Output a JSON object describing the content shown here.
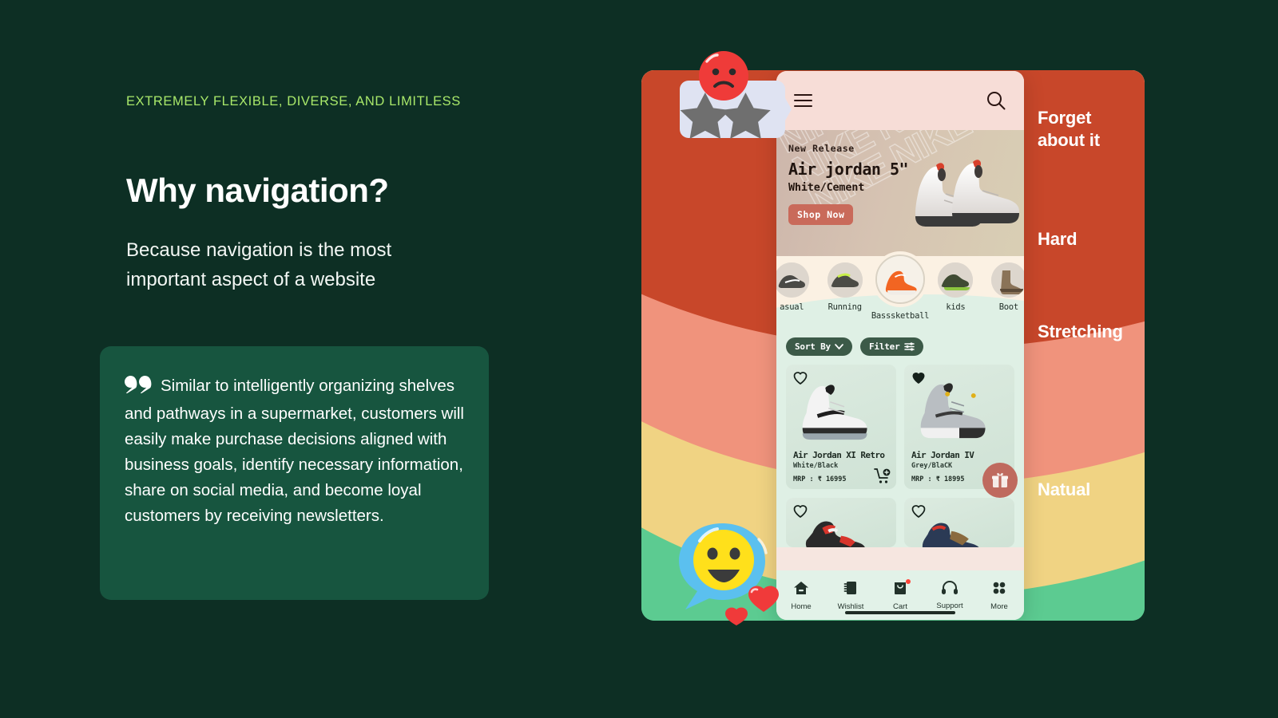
{
  "slide": {
    "eyebrow": "EXTREMELY FLEXIBLE, DIVERSE, AND LIMITLESS",
    "headline": "Why navigation?",
    "subhead": "Because navigation is the most important aspect of a website",
    "quote": "Similar to intelligently organizing shelves and pathways in a supermarket, customers will easily make purchase decisions aligned with business goals, identify necessary information, share on social media, and become loyal customers by receiving newsletters."
  },
  "colors": {
    "background": "#0d2f24",
    "eyebrow_green": "#a9e86a",
    "quote_card": "#17553f",
    "band_red": "#c8472a",
    "band_salmon": "#f0937c",
    "band_yellow": "#f0d383",
    "band_green": "#5ccb91",
    "accent_brick": "#c96a5a",
    "chip_dark": "#3c5a48",
    "badge_red": "#ff4438"
  },
  "bands": [
    {
      "label": "Forget about it",
      "color": "#c8472a"
    },
    {
      "label": "Hard",
      "color": "#f0937c"
    },
    {
      "label": "Stretching",
      "color": "#f0d383"
    },
    {
      "label": "Natual",
      "color": "#5ccb91"
    }
  ],
  "phone": {
    "topbar": {
      "menu_icon": "hamburger-icon",
      "search_icon": "search-icon"
    },
    "hero": {
      "watermark": "NIKE",
      "eyebrow": "New Release",
      "title": "Air jordan 5\"",
      "subtitle": "White/Cement",
      "cta": "Shop Now"
    },
    "categories": [
      {
        "label": "asual",
        "selected": false
      },
      {
        "label": "Running",
        "selected": false
      },
      {
        "label": "Basssketball",
        "selected": true
      },
      {
        "label": "kids",
        "selected": false
      },
      {
        "label": "Boot",
        "selected": false
      }
    ],
    "filters": {
      "sort_label": "Sort By",
      "filter_label": "Filter"
    },
    "products": [
      {
        "name": "Air Jordan XI Retro",
        "colour": "White/Black",
        "price": "MRP : ₹ 16995",
        "favourited": false
      },
      {
        "name": "Air Jordan IV",
        "colour": "Grey/BlaCK",
        "price": "MRP : ₹ 18995",
        "favourited": true
      }
    ],
    "fab": {
      "icon": "gift-icon"
    },
    "bottom_nav": [
      {
        "label": "Home",
        "icon": "home-icon",
        "badge": false
      },
      {
        "label": "Wishlist",
        "icon": "wishlist-icon",
        "badge": false
      },
      {
        "label": "Cart",
        "icon": "cart-icon",
        "badge": true
      },
      {
        "label": "Support",
        "icon": "headset-icon",
        "badge": false
      },
      {
        "label": "More",
        "icon": "grid-dots-icon",
        "badge": false
      }
    ]
  },
  "stickers": {
    "review": {
      "name": "sad-review-sticker",
      "stars": 2
    },
    "emoji": {
      "name": "smiley-chat-sticker"
    }
  }
}
